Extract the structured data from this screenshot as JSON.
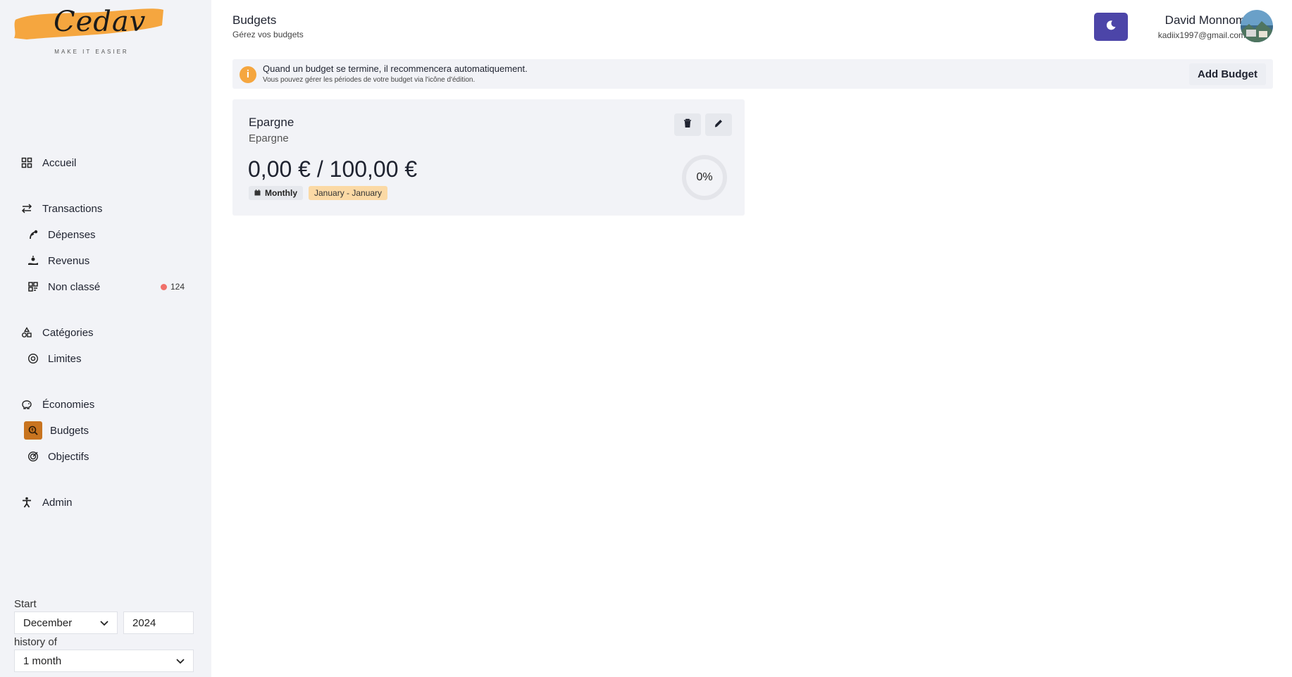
{
  "app": {
    "logo_text": "Cedav",
    "logo_tagline": "MAKE IT EASIER"
  },
  "sidebar": {
    "items": [
      {
        "label": "Accueil",
        "icon": "dashboard-icon"
      },
      {
        "label": "Transactions",
        "icon": "arrows-exchange-icon"
      },
      {
        "label": "Dépenses",
        "icon": "money-out-icon"
      },
      {
        "label": "Revenus",
        "icon": "money-in-icon"
      },
      {
        "label": "Non classé",
        "icon": "unclassified-icon",
        "badge": "124"
      },
      {
        "label": "Catégories",
        "icon": "shapes-icon"
      },
      {
        "label": "Limites",
        "icon": "target-circle-icon"
      },
      {
        "label": "Économies",
        "icon": "piggy-bank-icon"
      },
      {
        "label": "Budgets",
        "icon": "budget-search-icon",
        "active": true
      },
      {
        "label": "Objectifs",
        "icon": "goal-icon"
      },
      {
        "label": "Admin",
        "icon": "person-icon"
      }
    ]
  },
  "period": {
    "start_label": "Start",
    "month_value": "December",
    "year_value": "2024",
    "history_label": "history of",
    "history_value": "1 month"
  },
  "header": {
    "title": "Budgets",
    "subtitle": "Gérez vos budgets",
    "user_name": "David Monnom",
    "user_email": "kadiix1997@gmail.com"
  },
  "info": {
    "main": "Quand un budget se termine, il recommencera automatiquement.",
    "sub": "Vous pouvez gérer les périodes de votre budget via l'icône d'édition.",
    "add_button": "Add Budget"
  },
  "budget_card": {
    "title": "Epargne",
    "category": "Epargne",
    "amount": "0,00 € / 100,00 €",
    "frequency": "Monthly",
    "period": "January - January",
    "progress_label": "0%",
    "progress_fraction": 0
  },
  "colors": {
    "sidebar_bg": "#f2f3f7",
    "accent": "#4c45a8",
    "logo_brush": "#f5a63f",
    "active_item": "#c8741f",
    "badge_dot": "#f0706a",
    "period_chip": "#fbd9a5"
  }
}
